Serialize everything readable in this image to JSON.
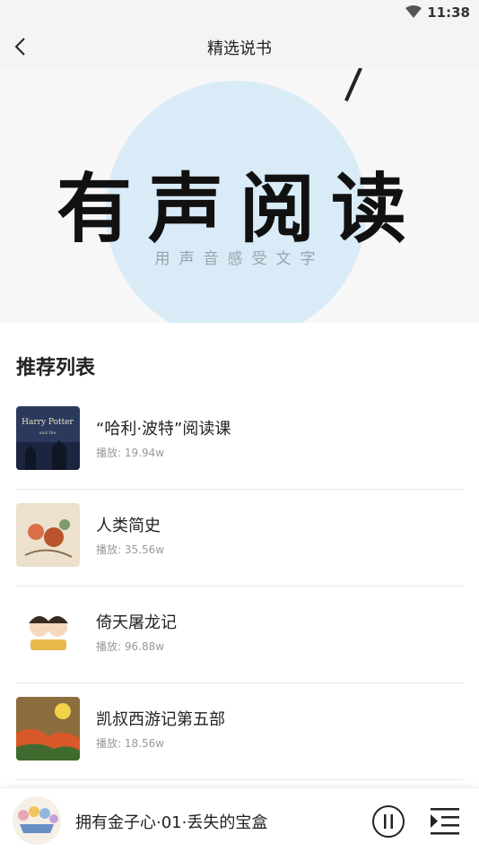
{
  "status_bar": {
    "time": "11:38"
  },
  "nav": {
    "title": "精选说书"
  },
  "banner": {
    "title": "有声阅读",
    "subtitle": "用声音感受文字"
  },
  "section": {
    "title": "推荐列表"
  },
  "items": [
    {
      "title": "“哈利·波特”阅读课",
      "plays": "播放: 19.94w"
    },
    {
      "title": "人类简史",
      "plays": "播放: 35.56w"
    },
    {
      "title": "倚天屠龙记",
      "plays": "播放: 96.88w"
    },
    {
      "title": "凯叔西游记第五部",
      "plays": "播放: 18.56w"
    }
  ],
  "player": {
    "title": "拥有金子心·01·丢失的宝盒"
  },
  "colors": {
    "background": "#ffffff",
    "bar": "#f4f4f4",
    "banner_circle": "#d9ebf7",
    "divider": "#e6e6e6"
  }
}
